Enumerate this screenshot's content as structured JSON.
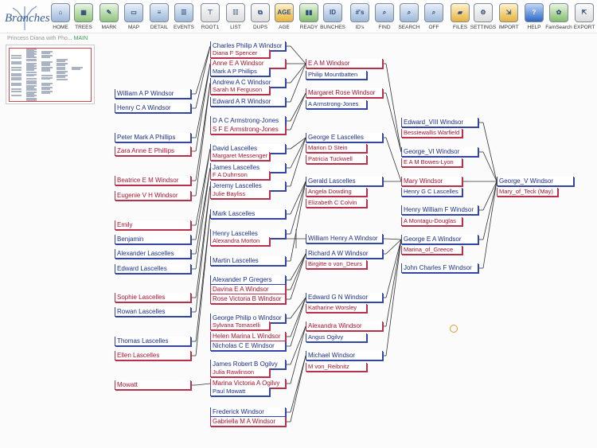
{
  "app": {
    "logo_text": "Branches",
    "title": "Princess Diana with Pho...",
    "mode": "MAIN"
  },
  "toolbar": [
    {
      "label": "HOME",
      "icon": "home-icon",
      "glyph": "⌂",
      "style": "bl"
    },
    {
      "label": "TREES",
      "icon": "trees-icon",
      "glyph": "▦",
      "style": "g"
    },
    {
      "label": "MARK",
      "icon": "mark-icon",
      "glyph": "✎",
      "style": "g"
    },
    {
      "label": "MAP",
      "icon": "map-icon",
      "glyph": "▭",
      "style": "bl"
    },
    {
      "label": "DETAIL",
      "icon": "detail-icon",
      "glyph": "≡",
      "style": "bl"
    },
    {
      "label": "EVENTS",
      "icon": "events-icon",
      "glyph": "☰",
      "style": "bl"
    },
    {
      "label": "ROOT1",
      "icon": "root-icon",
      "glyph": "⊤",
      "style": "gr"
    },
    {
      "label": "LIST",
      "icon": "list-icon",
      "glyph": "☷",
      "style": "gr"
    },
    {
      "label": "DUPS",
      "icon": "dups-icon",
      "glyph": "⧉",
      "style": "gr"
    },
    {
      "label": "AGE",
      "icon": "age-icon",
      "glyph": "AGE",
      "style": "o"
    },
    {
      "label": "READY",
      "icon": "ready-icon",
      "glyph": "▮▮",
      "style": "t"
    },
    {
      "label": "BUNCHES",
      "icon": "bunches-icon",
      "glyph": "ID",
      "style": "bl"
    },
    {
      "label": "ID's",
      "icon": "ids-icon",
      "glyph": "#'s",
      "style": "bl"
    },
    {
      "label": "FIND",
      "icon": "find-icon",
      "glyph": "⌕",
      "style": "bl"
    },
    {
      "label": "SEARCH",
      "icon": "search-icon",
      "glyph": "⌕",
      "style": "bl"
    },
    {
      "label": "OFF",
      "icon": "off-icon",
      "glyph": "⌕",
      "style": "bl"
    },
    {
      "label": "FILES",
      "icon": "folder-icon",
      "glyph": "▰",
      "style": "o"
    },
    {
      "label": "SETTINGS",
      "icon": "gear-icon",
      "glyph": "⚙",
      "style": "gr"
    },
    {
      "label": "IMPORT",
      "icon": "import-icon",
      "glyph": "⇲",
      "style": "o"
    },
    {
      "label": "HELP",
      "icon": "help-icon",
      "glyph": "?",
      "style": "b"
    },
    {
      "label": "FamSearch",
      "icon": "familysearch-icon",
      "glyph": "✿",
      "style": "t"
    },
    {
      "label": "EXPORT",
      "icon": "export-icon",
      "glyph": "⇱",
      "style": "gr"
    }
  ],
  "people": [
    {
      "id": "p1",
      "name": "Charles Philip A Windsor",
      "sex": "m"
    },
    {
      "id": "p2",
      "name": "Diana F Spencer",
      "sex": "f"
    },
    {
      "id": "p3",
      "name": "Anne E A Windsor",
      "sex": "f"
    },
    {
      "id": "p4",
      "name": "Mark A P Phillips",
      "sex": "m"
    },
    {
      "id": "p5",
      "name": "Andrew A C Windsor",
      "sex": "m"
    },
    {
      "id": "p6",
      "name": "Sarah M Ferguson",
      "sex": "f"
    },
    {
      "id": "p7",
      "name": "Edward A R Windsor",
      "sex": "m"
    },
    {
      "id": "p8",
      "name": "D A C Armstrong-Jones",
      "sex": "m"
    },
    {
      "id": "p9",
      "name": "S F E Armstrong-Jones",
      "sex": "f"
    },
    {
      "id": "p10",
      "name": "David Lascelles",
      "sex": "m"
    },
    {
      "id": "p11",
      "name": "Margaret Messenger",
      "sex": "f"
    },
    {
      "id": "p12",
      "name": "James Lascelles",
      "sex": "m"
    },
    {
      "id": "p13",
      "name": "F A Duhrrson",
      "sex": "f"
    },
    {
      "id": "p14",
      "name": "Jeremy Lascelles",
      "sex": "m"
    },
    {
      "id": "p15",
      "name": "Julie Bayliss",
      "sex": "f"
    },
    {
      "id": "p16",
      "name": "Mark Lascelles",
      "sex": "m"
    },
    {
      "id": "p17",
      "name": "Henry Lascelles",
      "sex": "m"
    },
    {
      "id": "p18",
      "name": "Alexandra Morton",
      "sex": "f"
    },
    {
      "id": "p19",
      "name": "Martin Lascelles",
      "sex": "m"
    },
    {
      "id": "p20",
      "name": "Alexander P Gregers",
      "sex": "m"
    },
    {
      "id": "p21",
      "name": "Davina E A Windsor",
      "sex": "f"
    },
    {
      "id": "p22",
      "name": "Rose Victoria B Windsor",
      "sex": "f"
    },
    {
      "id": "p23",
      "name": "George Philip o Windsor",
      "sex": "m"
    },
    {
      "id": "p24",
      "name": "Sylvana Tomaselli",
      "sex": "f"
    },
    {
      "id": "p25",
      "name": "Helen Marina L Windsor",
      "sex": "f"
    },
    {
      "id": "p26",
      "name": "Nicholas C E Windsor",
      "sex": "m"
    },
    {
      "id": "p27",
      "name": "James Robert B Ogilvy",
      "sex": "m"
    },
    {
      "id": "p28",
      "name": "Julia Rawlinson",
      "sex": "f"
    },
    {
      "id": "p29",
      "name": "Marina Victoria A Ogilvy",
      "sex": "f"
    },
    {
      "id": "p30",
      "name": "Paul Mowatt",
      "sex": "m"
    },
    {
      "id": "p31",
      "name": "Frederick Windsor",
      "sex": "m"
    },
    {
      "id": "p32",
      "name": "Gabriella M A Windsor",
      "sex": "f"
    },
    {
      "id": "c1",
      "name": "William A P Windsor",
      "sex": "m"
    },
    {
      "id": "c2",
      "name": "Henry C A Windsor",
      "sex": "m"
    },
    {
      "id": "c3",
      "name": "Peter Mark A Phillips",
      "sex": "m"
    },
    {
      "id": "c4",
      "name": "Zara Anne E Phillips",
      "sex": "f"
    },
    {
      "id": "c5",
      "name": "Beatrice E M Windsor",
      "sex": "f"
    },
    {
      "id": "c6",
      "name": "Eugenie V H Windsor",
      "sex": "f"
    },
    {
      "id": "c7",
      "name": "Emily",
      "sex": "f"
    },
    {
      "id": "c8",
      "name": "Benjamin",
      "sex": "m"
    },
    {
      "id": "c9",
      "name": "Alexander Lascelles",
      "sex": "m"
    },
    {
      "id": "c10",
      "name": "Edward Lascelles",
      "sex": "m"
    },
    {
      "id": "c11",
      "name": "Sophie Lascelles",
      "sex": "f"
    },
    {
      "id": "c12",
      "name": "Rowan Lascelles",
      "sex": "m"
    },
    {
      "id": "c13",
      "name": "Thomas Lascelles",
      "sex": "m"
    },
    {
      "id": "c14",
      "name": "Ellen Lascelles",
      "sex": "f"
    },
    {
      "id": "c15",
      "name": "Mowatt",
      "sex": "f"
    },
    {
      "id": "g1",
      "name": "E A M Windsor",
      "sex": "f"
    },
    {
      "id": "g2",
      "name": "Philip Mountbatten",
      "sex": "m"
    },
    {
      "id": "g3",
      "name": "Margaret Rose Windsor",
      "sex": "f"
    },
    {
      "id": "g4",
      "name": "A Armstrong-Jones",
      "sex": "m"
    },
    {
      "id": "g5",
      "name": "George E Lascelles",
      "sex": "m"
    },
    {
      "id": "g6",
      "name": "Marion D Stein",
      "sex": "f"
    },
    {
      "id": "g7",
      "name": "Patricia Tuckwell",
      "sex": "f"
    },
    {
      "id": "g8",
      "name": "Gerald Lascelles",
      "sex": "m"
    },
    {
      "id": "g9",
      "name": "Angela Dowding",
      "sex": "f"
    },
    {
      "id": "g10",
      "name": "Elizabeth C Colvin",
      "sex": "f"
    },
    {
      "id": "g11",
      "name": "William Henry A Windsor",
      "sex": "m"
    },
    {
      "id": "g12",
      "name": "Richard A W Windsor",
      "sex": "m"
    },
    {
      "id": "g13",
      "name": "Birgitte o von_Deurs",
      "sex": "f"
    },
    {
      "id": "g14",
      "name": "Edward G N Windsor",
      "sex": "m"
    },
    {
      "id": "g15",
      "name": "Katharine Worsley",
      "sex": "f"
    },
    {
      "id": "g16",
      "name": "Alexandra Windsor",
      "sex": "f"
    },
    {
      "id": "g17",
      "name": "Angus Ogilvy",
      "sex": "m"
    },
    {
      "id": "g18",
      "name": "Michael Windsor",
      "sex": "m"
    },
    {
      "id": "g19",
      "name": "M von_Reibnitz",
      "sex": "f"
    },
    {
      "id": "h1",
      "name": "Edward_VIII Windsor",
      "sex": "m"
    },
    {
      "id": "h2",
      "name": "Bessiewallis Warfield",
      "sex": "f"
    },
    {
      "id": "h3",
      "name": "George_VI Windsor",
      "sex": "m"
    },
    {
      "id": "h4",
      "name": "E A M Bowes-Lyon",
      "sex": "f"
    },
    {
      "id": "h5",
      "name": "Mary Windsor",
      "sex": "f"
    },
    {
      "id": "h6",
      "name": "Henry G C Lascelles",
      "sex": "m"
    },
    {
      "id": "h7",
      "name": "Henry William F Windsor",
      "sex": "m"
    },
    {
      "id": "h8",
      "name": "A Montagu-Douglas",
      "sex": "f"
    },
    {
      "id": "h9",
      "name": "George E A Windsor",
      "sex": "m"
    },
    {
      "id": "h10",
      "name": "Marina_of_Greece",
      "sex": "f"
    },
    {
      "id": "h11",
      "name": "John Charles F Windsor",
      "sex": "m"
    },
    {
      "id": "r1",
      "name": "George_V Windsor",
      "sex": "m"
    },
    {
      "id": "r2",
      "name": "Mary_of_Teck (May)",
      "sex": "f"
    }
  ]
}
